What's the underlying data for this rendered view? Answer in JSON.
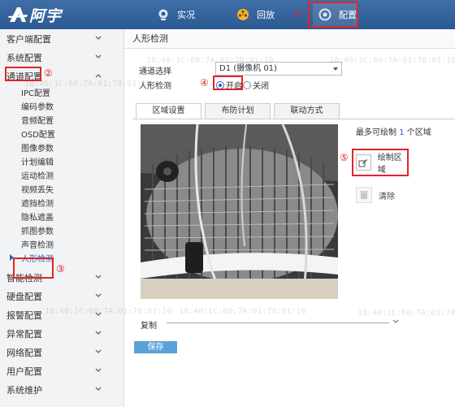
{
  "brand": {
    "name": "阿宇"
  },
  "nav": {
    "live": "实况",
    "playback": "回放",
    "config": "配置",
    "config_marker": "①"
  },
  "sidebar": {
    "items": [
      {
        "label": "客户端配置"
      },
      {
        "label": "系统配置"
      },
      {
        "label": "通道配置",
        "marker": "②"
      }
    ],
    "sub_items": [
      "IPC配置",
      "编码参数",
      "音频配置",
      "OSD配置",
      "图像参数",
      "计划编辑",
      "运动检测",
      "视频丢失",
      "遮挡检测",
      "隐私遮盖",
      "抓图参数",
      "声音检测"
    ],
    "active_sub": {
      "label": "人形检测",
      "marker": "③"
    },
    "bottom_items": [
      "智能检测",
      "硬盘配置",
      "报警配置",
      "异常配置",
      "网络配置",
      "用户配置",
      "系统维护"
    ]
  },
  "page": {
    "title": "人形检测",
    "channel_label": "通道选择",
    "channel_value": "D1 (摄像机 01)",
    "detect_label": "人形检测",
    "radio_on": "开启",
    "radio_off": "关闭",
    "radio_marker": "④",
    "detect_enabled": true,
    "tabs": [
      "区域设置",
      "布防计划",
      "联动方式"
    ],
    "max_text_prefix": "最多可绘制",
    "max_count": "1",
    "max_text_suffix": "个区域",
    "draw_label": "绘制区域",
    "draw_marker": "⑤",
    "clear_label": "清除",
    "copy_label": "复制",
    "save_label": "保存"
  },
  "watermark": "18:40:1C:60:7A:01:78:01:10",
  "colors": {
    "topbar": "#2b5a92",
    "accent": "#2a62c9",
    "annotation": "#e0252b",
    "save": "#5aa3d8"
  }
}
